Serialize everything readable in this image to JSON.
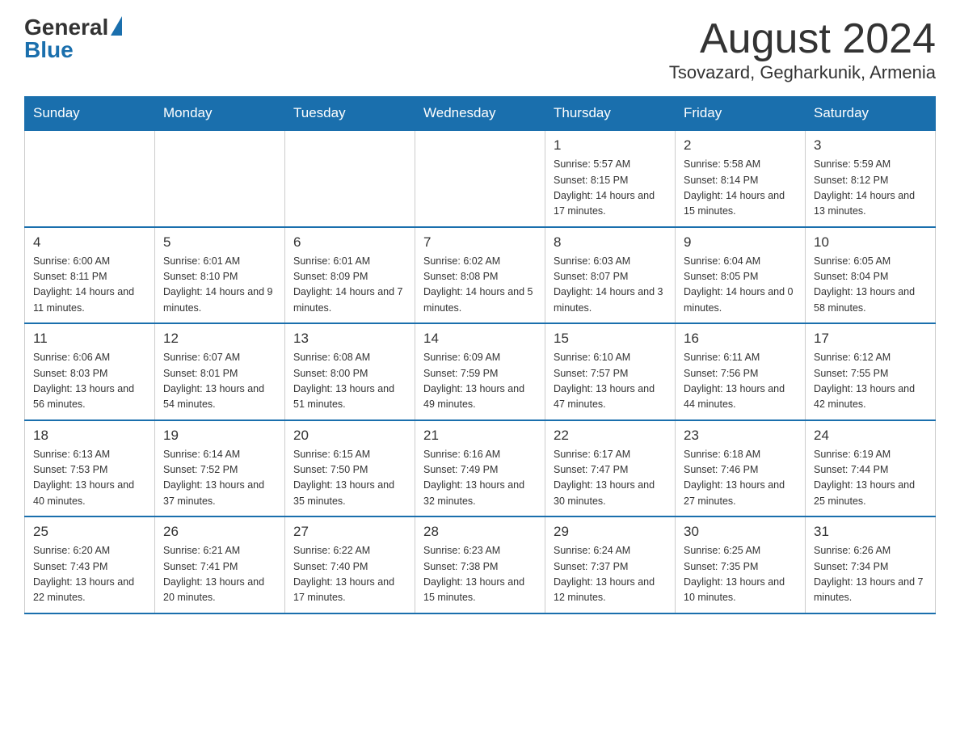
{
  "header": {
    "logo_general": "General",
    "logo_blue": "Blue",
    "month_title": "August 2024",
    "location": "Tsovazard, Gegharkunik, Armenia"
  },
  "weekdays": [
    "Sunday",
    "Monday",
    "Tuesday",
    "Wednesday",
    "Thursday",
    "Friday",
    "Saturday"
  ],
  "weeks": [
    [
      {
        "day": "",
        "info": ""
      },
      {
        "day": "",
        "info": ""
      },
      {
        "day": "",
        "info": ""
      },
      {
        "day": "",
        "info": ""
      },
      {
        "day": "1",
        "info": "Sunrise: 5:57 AM\nSunset: 8:15 PM\nDaylight: 14 hours and 17 minutes."
      },
      {
        "day": "2",
        "info": "Sunrise: 5:58 AM\nSunset: 8:14 PM\nDaylight: 14 hours and 15 minutes."
      },
      {
        "day": "3",
        "info": "Sunrise: 5:59 AM\nSunset: 8:12 PM\nDaylight: 14 hours and 13 minutes."
      }
    ],
    [
      {
        "day": "4",
        "info": "Sunrise: 6:00 AM\nSunset: 8:11 PM\nDaylight: 14 hours and 11 minutes."
      },
      {
        "day": "5",
        "info": "Sunrise: 6:01 AM\nSunset: 8:10 PM\nDaylight: 14 hours and 9 minutes."
      },
      {
        "day": "6",
        "info": "Sunrise: 6:01 AM\nSunset: 8:09 PM\nDaylight: 14 hours and 7 minutes."
      },
      {
        "day": "7",
        "info": "Sunrise: 6:02 AM\nSunset: 8:08 PM\nDaylight: 14 hours and 5 minutes."
      },
      {
        "day": "8",
        "info": "Sunrise: 6:03 AM\nSunset: 8:07 PM\nDaylight: 14 hours and 3 minutes."
      },
      {
        "day": "9",
        "info": "Sunrise: 6:04 AM\nSunset: 8:05 PM\nDaylight: 14 hours and 0 minutes."
      },
      {
        "day": "10",
        "info": "Sunrise: 6:05 AM\nSunset: 8:04 PM\nDaylight: 13 hours and 58 minutes."
      }
    ],
    [
      {
        "day": "11",
        "info": "Sunrise: 6:06 AM\nSunset: 8:03 PM\nDaylight: 13 hours and 56 minutes."
      },
      {
        "day": "12",
        "info": "Sunrise: 6:07 AM\nSunset: 8:01 PM\nDaylight: 13 hours and 54 minutes."
      },
      {
        "day": "13",
        "info": "Sunrise: 6:08 AM\nSunset: 8:00 PM\nDaylight: 13 hours and 51 minutes."
      },
      {
        "day": "14",
        "info": "Sunrise: 6:09 AM\nSunset: 7:59 PM\nDaylight: 13 hours and 49 minutes."
      },
      {
        "day": "15",
        "info": "Sunrise: 6:10 AM\nSunset: 7:57 PM\nDaylight: 13 hours and 47 minutes."
      },
      {
        "day": "16",
        "info": "Sunrise: 6:11 AM\nSunset: 7:56 PM\nDaylight: 13 hours and 44 minutes."
      },
      {
        "day": "17",
        "info": "Sunrise: 6:12 AM\nSunset: 7:55 PM\nDaylight: 13 hours and 42 minutes."
      }
    ],
    [
      {
        "day": "18",
        "info": "Sunrise: 6:13 AM\nSunset: 7:53 PM\nDaylight: 13 hours and 40 minutes."
      },
      {
        "day": "19",
        "info": "Sunrise: 6:14 AM\nSunset: 7:52 PM\nDaylight: 13 hours and 37 minutes."
      },
      {
        "day": "20",
        "info": "Sunrise: 6:15 AM\nSunset: 7:50 PM\nDaylight: 13 hours and 35 minutes."
      },
      {
        "day": "21",
        "info": "Sunrise: 6:16 AM\nSunset: 7:49 PM\nDaylight: 13 hours and 32 minutes."
      },
      {
        "day": "22",
        "info": "Sunrise: 6:17 AM\nSunset: 7:47 PM\nDaylight: 13 hours and 30 minutes."
      },
      {
        "day": "23",
        "info": "Sunrise: 6:18 AM\nSunset: 7:46 PM\nDaylight: 13 hours and 27 minutes."
      },
      {
        "day": "24",
        "info": "Sunrise: 6:19 AM\nSunset: 7:44 PM\nDaylight: 13 hours and 25 minutes."
      }
    ],
    [
      {
        "day": "25",
        "info": "Sunrise: 6:20 AM\nSunset: 7:43 PM\nDaylight: 13 hours and 22 minutes."
      },
      {
        "day": "26",
        "info": "Sunrise: 6:21 AM\nSunset: 7:41 PM\nDaylight: 13 hours and 20 minutes."
      },
      {
        "day": "27",
        "info": "Sunrise: 6:22 AM\nSunset: 7:40 PM\nDaylight: 13 hours and 17 minutes."
      },
      {
        "day": "28",
        "info": "Sunrise: 6:23 AM\nSunset: 7:38 PM\nDaylight: 13 hours and 15 minutes."
      },
      {
        "day": "29",
        "info": "Sunrise: 6:24 AM\nSunset: 7:37 PM\nDaylight: 13 hours and 12 minutes."
      },
      {
        "day": "30",
        "info": "Sunrise: 6:25 AM\nSunset: 7:35 PM\nDaylight: 13 hours and 10 minutes."
      },
      {
        "day": "31",
        "info": "Sunrise: 6:26 AM\nSunset: 7:34 PM\nDaylight: 13 hours and 7 minutes."
      }
    ]
  ]
}
